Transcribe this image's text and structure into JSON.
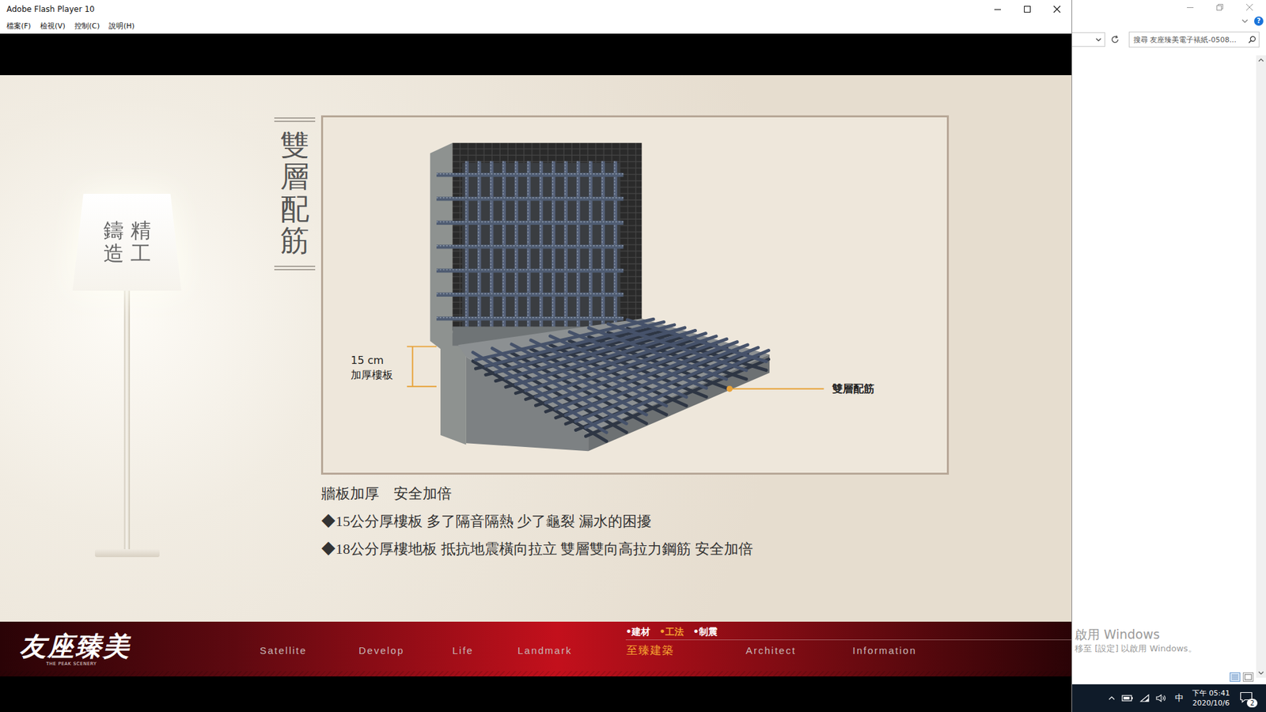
{
  "window": {
    "title": "Adobe Flash Player 10"
  },
  "menu": [
    "檔案(F)",
    "檢視(V)",
    "控制(C)",
    "說明(H)"
  ],
  "lamp": {
    "columns": [
      "精工",
      "鑄造"
    ]
  },
  "section_title": "雙層配筋",
  "diagram": {
    "thickness_value": "15 cm",
    "thickness_label": "加厚樓板",
    "callout": "雙層配筋"
  },
  "heading": "牆板加厚　安全加倍",
  "bullets": [
    "◆15公分厚樓板 多了隔音隔熱 少了龜裂 漏水的困擾",
    "◆18公分厚樓地板 抵抗地震橫向拉立 雙層雙向高拉力鋼筋 安全加倍"
  ],
  "logo": {
    "name": "友座臻美",
    "tagline": "THE PEAK SCENERY"
  },
  "subnav": [
    {
      "label": "•建材",
      "selected": false
    },
    {
      "label": "•工法",
      "selected": true
    },
    {
      "label": "•制震",
      "selected": false
    }
  ],
  "nav": [
    {
      "label": "Satellite",
      "selected": false
    },
    {
      "label": "Develop",
      "selected": false
    },
    {
      "label": "Life",
      "selected": false
    },
    {
      "label": "Landmark",
      "selected": false
    },
    {
      "label": "至臻建築",
      "selected": true
    },
    {
      "label": "Architect",
      "selected": false
    },
    {
      "label": "Information",
      "selected": false
    }
  ],
  "background_window": {
    "search_placeholder": "搜尋 友座臻美電子裱紙-0508...",
    "help": "?"
  },
  "watermark": {
    "title": "啟用 Windows",
    "subtitle": "移至 [設定] 以啟用 Windows。"
  },
  "taskbar": {
    "ime": "中",
    "time": "下午 05:41",
    "date": "2020/10/6",
    "notifications": "2"
  }
}
